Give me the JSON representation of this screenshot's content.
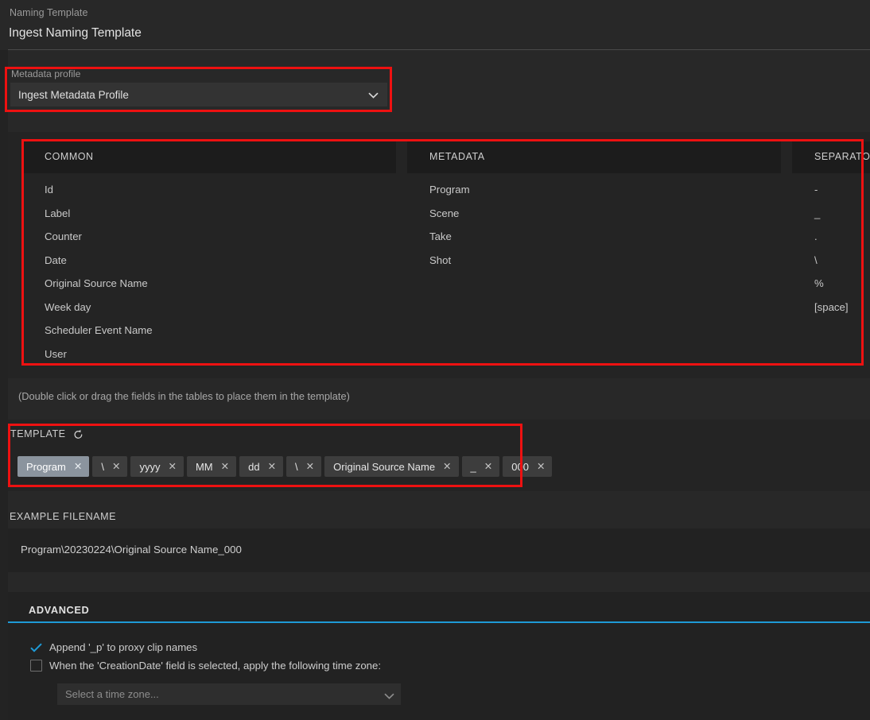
{
  "header": {
    "eyebrow": "Naming Template",
    "title": "Ingest Naming Template"
  },
  "metadata_profile": {
    "label": "Metadata profile",
    "selected": "Ingest Metadata Profile",
    "options": [
      "Ingest Metadata Profile"
    ],
    "chevron_icon": "chevron-down-icon"
  },
  "tables": {
    "common": {
      "header": "COMMON",
      "items": [
        "Id",
        "Label",
        "Counter",
        "Date",
        "Original Source Name",
        "Week day",
        "Scheduler Event Name",
        "User"
      ]
    },
    "metadata": {
      "header": "METADATA",
      "items": [
        "Program",
        "Scene",
        "Take",
        "Shot"
      ]
    },
    "separator": {
      "header": "SEPARATOR",
      "items": [
        "-",
        "_",
        ".",
        "\\",
        "%",
        "[space]"
      ]
    }
  },
  "hint": "(Double click or drag the fields in the tables to place them in the template)",
  "template": {
    "title": "TEMPLATE",
    "reset_icon": "reset-counterclockwise-icon",
    "remove_icon": "close-x-icon",
    "chips": [
      {
        "label": "Program",
        "selected": true
      },
      {
        "label": "\\",
        "selected": false
      },
      {
        "label": "yyyy",
        "selected": false
      },
      {
        "label": "MM",
        "selected": false
      },
      {
        "label": "dd",
        "selected": false
      },
      {
        "label": "\\",
        "selected": false
      },
      {
        "label": "Original Source Name",
        "selected": false
      },
      {
        "label": "_",
        "selected": false
      },
      {
        "label": "000",
        "selected": false
      }
    ]
  },
  "example": {
    "label": "EXAMPLE FILENAME",
    "value": "Program\\20230224\\Original Source Name_000"
  },
  "advanced": {
    "title": "ADVANCED",
    "accent_color": "#1e9ad6",
    "proxy_option": {
      "label": "Append '_p' to proxy clip names",
      "checked": true,
      "icon": "checkmark-icon"
    },
    "timezone_option": {
      "label": "When the 'CreationDate' field is selected, apply the following time zone:",
      "checked": false,
      "icon": "empty-checkbox-icon"
    },
    "timezone_select": {
      "placeholder": "Select a time zone...",
      "value": "",
      "chevron_icon": "chevron-down-icon"
    }
  },
  "annotations": {
    "highlight_color": "#ee1111",
    "boxes": [
      "metadata-profile",
      "field-tables",
      "template-chips"
    ]
  }
}
